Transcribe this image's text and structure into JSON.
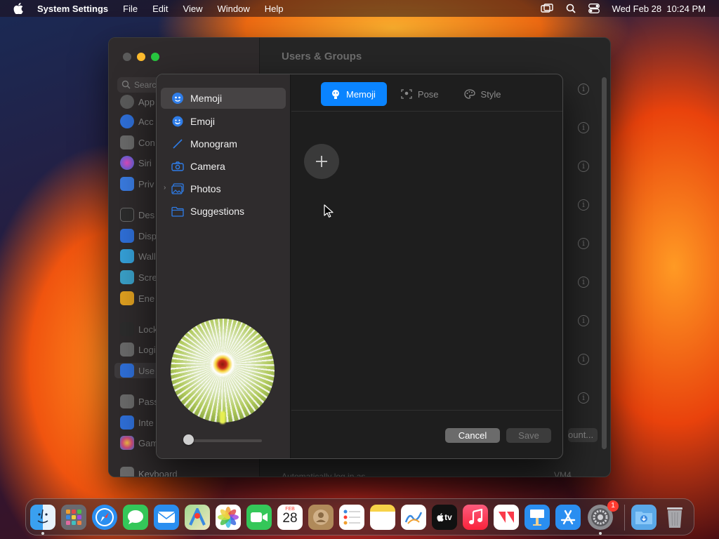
{
  "menubar": {
    "app_name": "System Settings",
    "items": [
      "File",
      "Edit",
      "View",
      "Window",
      "Help"
    ],
    "datetime": "Wed Feb 28  10:24 PM"
  },
  "settings_window": {
    "title": "Users & Groups",
    "search_placeholder": "Search",
    "sidebar_items": [
      {
        "label": "Appearance",
        "icon": "appearance-icon",
        "color": "#5a5a5a"
      },
      {
        "label": "Accessibility",
        "icon": "accessibility-icon",
        "color": "#2f6fd8"
      },
      {
        "label": "Control Centre",
        "icon": "control-centre-icon",
        "color": "#6a6a6a"
      },
      {
        "label": "Siri & Spotlight",
        "icon": "siri-icon",
        "color": "#8a3fc9"
      },
      {
        "label": "Privacy & Security",
        "icon": "hand-icon",
        "color": "#3a7be0"
      },
      {
        "label": "Desktop & Dock",
        "icon": "desktop-icon",
        "color": "#2c2c2c"
      },
      {
        "label": "Displays",
        "icon": "displays-icon",
        "color": "#2f6fd8"
      },
      {
        "label": "Wallpaper",
        "icon": "wallpaper-icon",
        "color": "#35a0d8"
      },
      {
        "label": "Screen Saver",
        "icon": "screensaver-icon",
        "color": "#3aa0c8"
      },
      {
        "label": "Energy Saver",
        "icon": "energy-icon",
        "color": "#e0a020"
      },
      {
        "label": "Lock Screen",
        "icon": "lock-icon",
        "color": "#2c2c2c"
      },
      {
        "label": "Login Password",
        "icon": "login-icon",
        "color": "#6a6a6a"
      },
      {
        "label": "Users & Groups",
        "icon": "users-icon",
        "color": "#2f6fd8"
      },
      {
        "label": "Passwords",
        "icon": "key-icon",
        "color": "#6a6a6a"
      },
      {
        "label": "Internet Accounts",
        "icon": "at-icon",
        "color": "#2f6fd8"
      },
      {
        "label": "Game Center",
        "icon": "gamecenter-icon",
        "color": "#d04a7a"
      },
      {
        "label": "Keyboard",
        "icon": "keyboard-icon",
        "color": "#6a6a6a"
      }
    ],
    "visible_labels": [
      "App",
      "Acc",
      "Con",
      "Siri",
      "Priv",
      "Des",
      "Disp",
      "Wall",
      "Scre",
      "Ene",
      "Lock",
      "Logi",
      "Use",
      "Pass",
      "Inte",
      "Gam",
      "Keyboard"
    ],
    "account_button": "ount...",
    "autologin_label": "Automatically log in as",
    "autologin_value": "VM4"
  },
  "dialog": {
    "sidebar": [
      {
        "label": "Memoji",
        "icon": "memoji-icon"
      },
      {
        "label": "Emoji",
        "icon": "emoji-icon"
      },
      {
        "label": "Monogram",
        "icon": "pencil-icon"
      },
      {
        "label": "Camera",
        "icon": "camera-icon"
      },
      {
        "label": "Photos",
        "icon": "photos-icon"
      },
      {
        "label": "Suggestions",
        "icon": "folder-icon"
      }
    ],
    "tabs": [
      {
        "label": "Memoji",
        "icon": "memoji-icon"
      },
      {
        "label": "Pose",
        "icon": "pose-icon"
      },
      {
        "label": "Style",
        "icon": "palette-icon"
      }
    ],
    "add_symbol": "+",
    "cancel_label": "Cancel",
    "save_label": "Save",
    "zoom_level": 0
  },
  "dock": {
    "apps": [
      "Finder",
      "Launchpad",
      "Safari",
      "Messages",
      "Mail",
      "Maps",
      "Photos",
      "FaceTime",
      "Calendar",
      "Contacts",
      "Reminders",
      "Notes",
      "Freeform",
      "TV",
      "Music",
      "News",
      "Keynote",
      "App Store",
      "System Settings",
      "Downloads",
      "Trash"
    ],
    "calendar_month": "FEB",
    "calendar_day": "28",
    "tv_label": "tv",
    "settings_badge": "1"
  },
  "colors": {
    "accent": "#0a84ff",
    "dialog_bg": "#1e1e1e",
    "sidebar_bg": "#2f2c2d"
  }
}
